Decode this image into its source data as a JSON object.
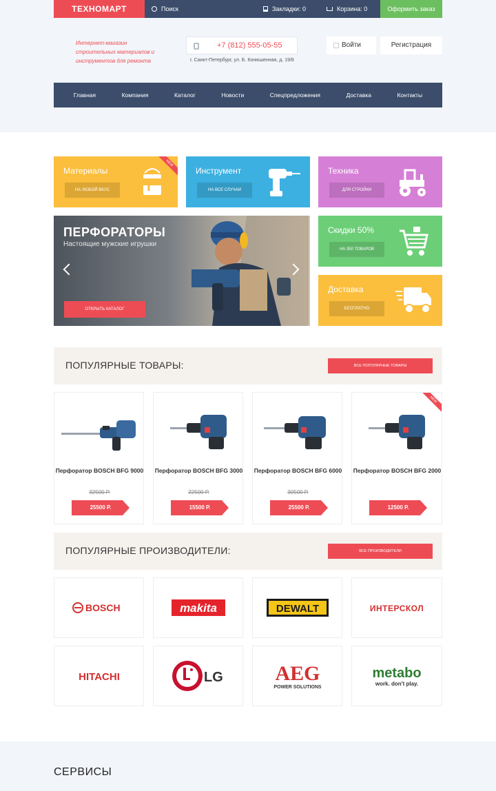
{
  "topbar": {
    "logo": "ТЕХНОМАРТ",
    "search_label": "Поиск",
    "bookmarks_label": "Закладки: 0",
    "cart_label": "Корзина: 0",
    "order_label": "Оформить заказ"
  },
  "header": {
    "tagline": "Интернет-магазин строительных материалов и инструментов для ремонта",
    "phone": "+7 (812) 555-05-55",
    "address": "г. Санкт-Петербург, ул. Б. Конюшенная, д. 19/8",
    "login_label": "Войти",
    "register_label": "Регистрация"
  },
  "nav": {
    "items": [
      "Главная",
      "Компания",
      "Каталог",
      "Новости",
      "Спецпредложения",
      "Доставка",
      "Контакты"
    ]
  },
  "categories": [
    {
      "title": "Материалы",
      "button": "НА ЛЮБОЙ ВКУС",
      "color": "#fbbe3d",
      "badge": "NEW",
      "icon": "paint-bucket-icon"
    },
    {
      "title": "Инструмент",
      "button": "НА ВСЕ СЛУЧАИ",
      "color": "#3cb0e0",
      "badge": "",
      "icon": "drill-icon"
    },
    {
      "title": "Техника",
      "button": "ДЛЯ СТРОЙКИ",
      "color": "#d67fd6",
      "badge": "",
      "icon": "tractor-icon"
    },
    {
      "title": "Скидки 50%",
      "button": "НА 350 ТОВАРОВ",
      "color": "#6ccf77",
      "badge": "",
      "icon": "cart-icon"
    },
    {
      "title": "Доставка",
      "button": "БЕСПЛАТНО",
      "color": "#fbbe3d",
      "badge": "",
      "icon": "truck-icon"
    }
  ],
  "hero": {
    "title": "ПЕРФОРАТОРЫ",
    "subtitle": "Настоящие мужские игрушки",
    "button": "ОТКРЫТЬ КАТАЛОГ"
  },
  "popular_products": {
    "title": "ПОПУЛЯРНЫЕ ТОВАРЫ:",
    "button": "ВСЕ ПОПУЛЯРНЫЕ ТОВАРЫ",
    "items": [
      {
        "name": "Перфоратор BOSCH BFG 9000",
        "old_price": "32500 Р.",
        "price": "25500 Р.",
        "badge": ""
      },
      {
        "name": "Перфоратор BOSCH BFG 3000",
        "old_price": "22500 Р.",
        "price": "15500 Р.",
        "badge": ""
      },
      {
        "name": "Перфоратор BOSCH BFG 6000",
        "old_price": "30500 Р.",
        "price": "25500 Р.",
        "badge": ""
      },
      {
        "name": "Перфоратор BOSCH BFG 2000",
        "old_price": "",
        "price": "12500 Р.",
        "badge": "NEW"
      }
    ]
  },
  "popular_brands": {
    "title": "ПОПУЛЯРНЫЕ ПРОИЗВОДИТЕЛИ:",
    "button": "ВСЕ ПРОИЗВОДИТЕЛИ",
    "items": [
      "BOSCH",
      "makita",
      "DEWALT",
      "ИНТЕРСКОЛ",
      "HITACHI",
      "LG",
      "AEG",
      "metabo"
    ],
    "aeg_sub": "POWER SOLUTIONS",
    "metabo_sub": "work. don't play."
  },
  "services": {
    "title": "СЕРВИСЫ"
  },
  "colors": {
    "accent": "#ee4c55",
    "navy": "#3b4d6b",
    "green": "#6cbf5e"
  }
}
